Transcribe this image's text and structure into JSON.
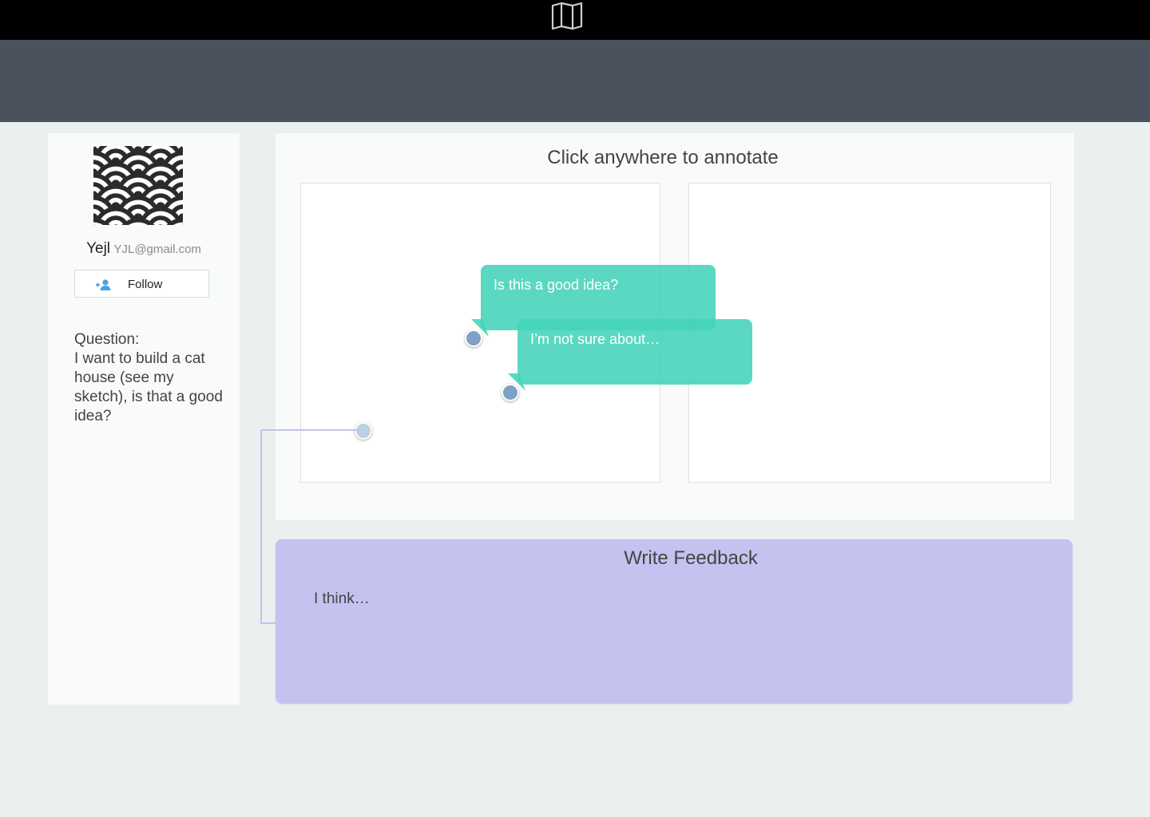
{
  "header": {
    "logo_icon": "folded-map-icon",
    "bar_color": "#000000",
    "subheader_color": "#4a535d"
  },
  "sidebar": {
    "avatar_icon": "seigaiha-wave-pattern-avatar",
    "user_name": "Yejl",
    "user_email": "YJL@gmail.com",
    "follow_label": "Follow",
    "follow_icon": "add-user-icon",
    "question_label": "Question:",
    "question_text": "I want to build a cat house (see my sketch), is that a good idea?"
  },
  "canvas": {
    "title": "Click anywhere to annotate",
    "annotations": [
      {
        "text": "Is this a good idea?"
      },
      {
        "text": "I’m not sure about…"
      }
    ]
  },
  "feedback": {
    "title": "Write Feedback",
    "placeholder": "I think…"
  },
  "colors": {
    "bubble": "#43d3b8",
    "feedback_bg": "#c4c2ef",
    "pin": "#7fa1c6",
    "pin_pending": "#bcd0e4"
  }
}
